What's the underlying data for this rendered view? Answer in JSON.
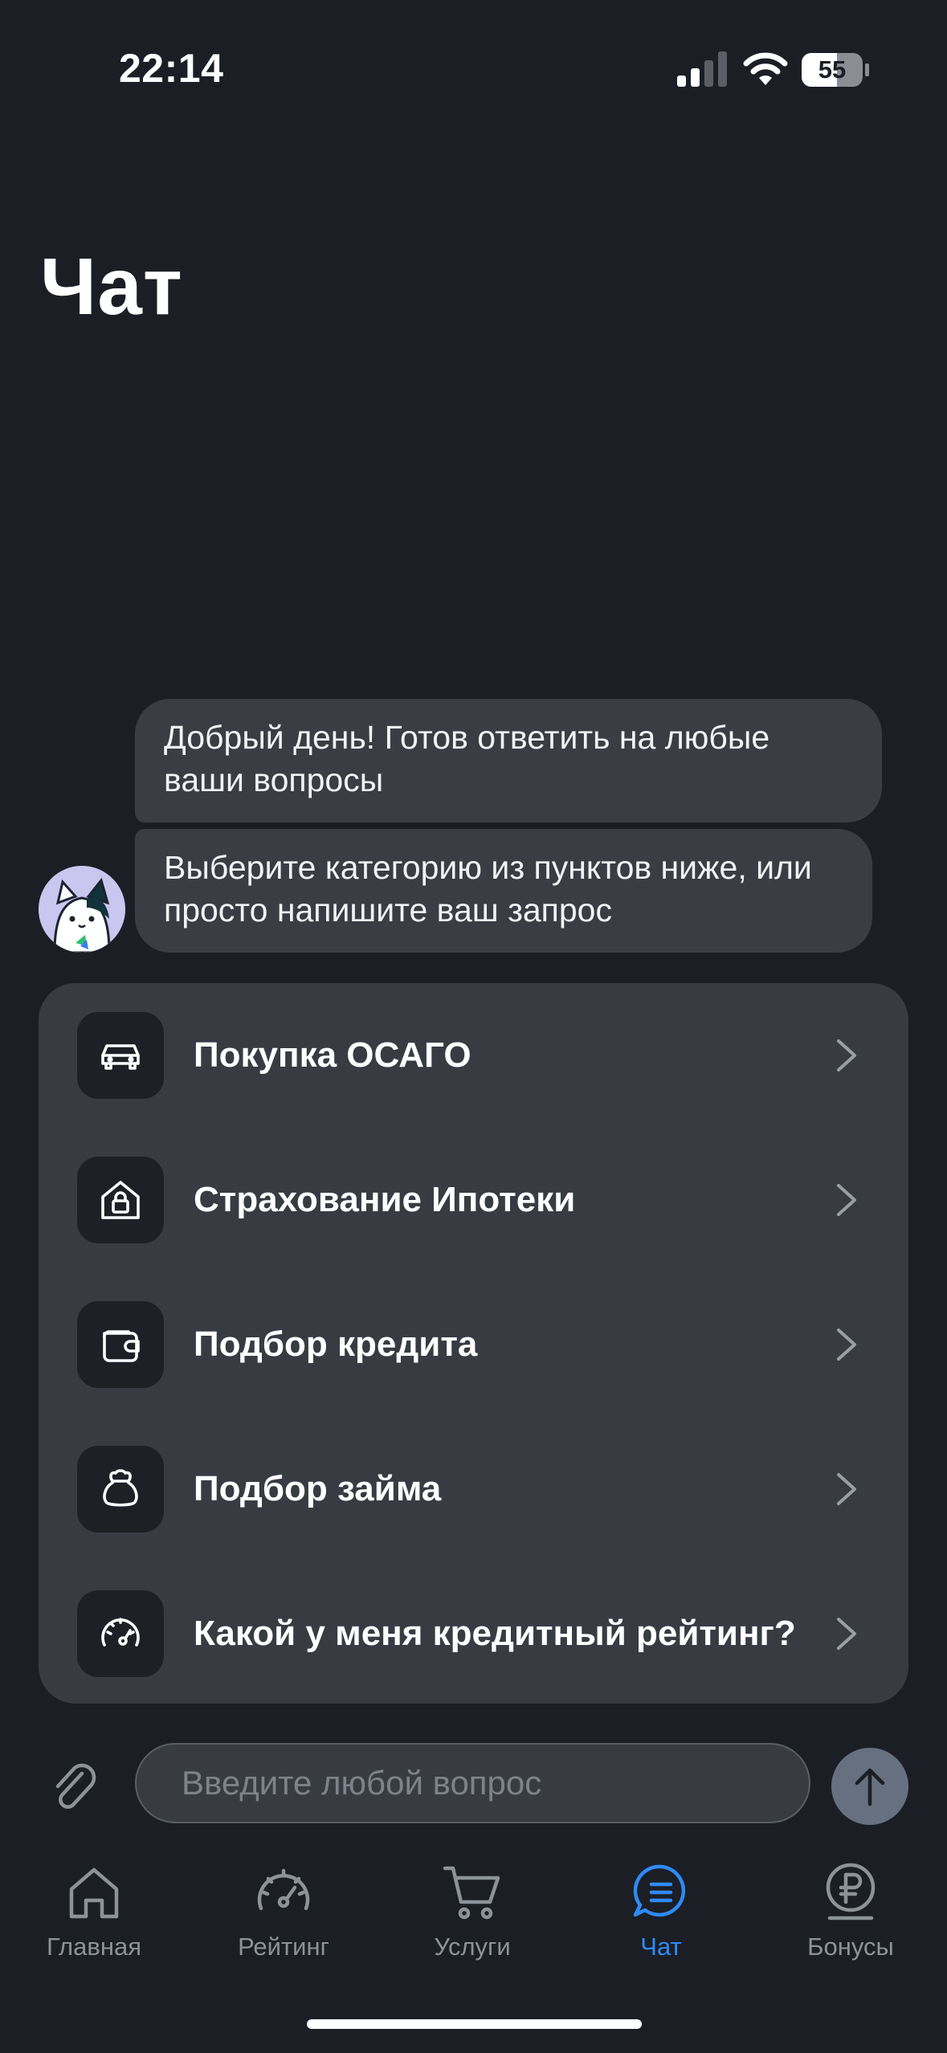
{
  "status_bar": {
    "time": "22:14",
    "battery": "55"
  },
  "page": {
    "title": "Чат"
  },
  "messages": [
    {
      "text": "Добрый день! Готов ответить на любые ваши вопросы"
    },
    {
      "text": "Выберите категорию из пунктов ниже, или просто напишите ваш запрос"
    }
  ],
  "categories": [
    {
      "label": "Покупка ОСАГО",
      "icon": "car-icon"
    },
    {
      "label": "Страхование Ипотеки",
      "icon": "house-lock-icon"
    },
    {
      "label": "Подбор кредита",
      "icon": "wallet-icon"
    },
    {
      "label": "Подбор займа",
      "icon": "money-bag-icon"
    },
    {
      "label": "Какой у меня кредитный рейтинг?",
      "icon": "speedometer-icon"
    }
  ],
  "input": {
    "placeholder": "Введите любой вопрос"
  },
  "tabs": [
    {
      "label": "Главная",
      "icon": "home-icon"
    },
    {
      "label": "Рейтинг",
      "icon": "gauge-icon"
    },
    {
      "label": "Услуги",
      "icon": "cart-icon"
    },
    {
      "label": "Чат",
      "icon": "chat-icon",
      "active": true
    },
    {
      "label": "Бонусы",
      "icon": "ruble-coin-icon"
    }
  ],
  "colors": {
    "background": "#1b1e25",
    "bubble": "#3a3d44",
    "card": "#383b42",
    "accent": "#2f8af5",
    "inactive": "#8d929a"
  }
}
